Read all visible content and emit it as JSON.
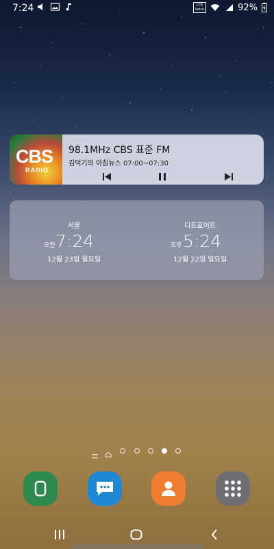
{
  "status_bar": {
    "time": "7:24",
    "battery": "92%",
    "volte_top": "LTE",
    "volte_bottom": "Voice"
  },
  "media_widget": {
    "station_logo_text": "CBS",
    "station_logo_sub": "RADIO",
    "title": "98.1MHz CBS 표준 FM",
    "subtitle": "김덕기의 아침뉴스 07:00~07:30",
    "icons": [
      "previous-icon",
      "pause-icon",
      "next-icon"
    ]
  },
  "clock_widget": {
    "clocks": [
      {
        "city": "서울",
        "ampm": "오전",
        "time": "7:24",
        "date": "12월 23일 월요일"
      },
      {
        "city": "디트로이트",
        "ampm": "오후",
        "time": "5:24",
        "date": "12월 22일 일요일"
      }
    ]
  },
  "pager": {
    "page_count": 5,
    "active_index": 4
  },
  "dock": {
    "apps": [
      {
        "name": "phone",
        "color": "#2e8b4f"
      },
      {
        "name": "messages",
        "color": "#1e88d4"
      },
      {
        "name": "contacts",
        "color": "#ef7d2f"
      },
      {
        "name": "apps",
        "color": "#6d6f73"
      }
    ]
  },
  "nav_bar": {
    "icons": [
      "recents-icon",
      "home-icon",
      "back-icon"
    ]
  }
}
